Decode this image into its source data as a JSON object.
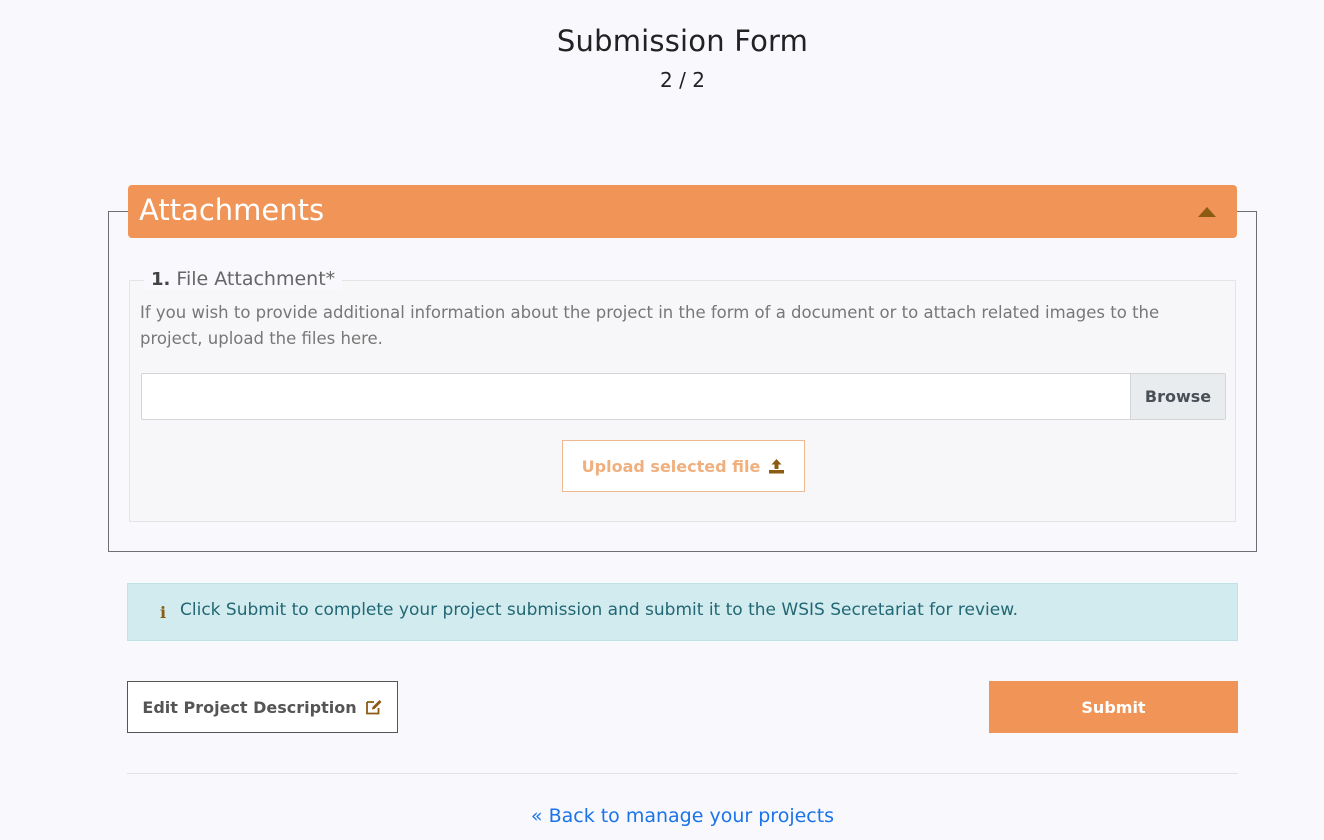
{
  "header": {
    "title": "Submission Form",
    "step": "2 / 2"
  },
  "attachments": {
    "title": "Attachments",
    "collapse_icon": "caret-up-icon",
    "field": {
      "number": "1.",
      "label": "File Attachment",
      "required_mark": "*",
      "help": "If you wish to provide additional information about the project in the form of a document or to attach related images to the project, upload the files here.",
      "file_value": "",
      "browse_label": "Browse",
      "upload_label": "Upload selected file",
      "upload_icon": "upload-icon"
    }
  },
  "alert": {
    "icon": "info-icon",
    "text": "Click Submit to complete your project submission and submit it to the WSIS Secretariat for review."
  },
  "actions": {
    "edit_label": "Edit Project Description",
    "edit_icon": "edit-icon",
    "submit_label": "Submit"
  },
  "footer": {
    "back_link": "« Back to manage your projects"
  },
  "colors": {
    "accent": "#f09458",
    "alert_bg": "#d1ebef",
    "link": "#1a73e8",
    "icon_brown": "#8b5b12"
  }
}
